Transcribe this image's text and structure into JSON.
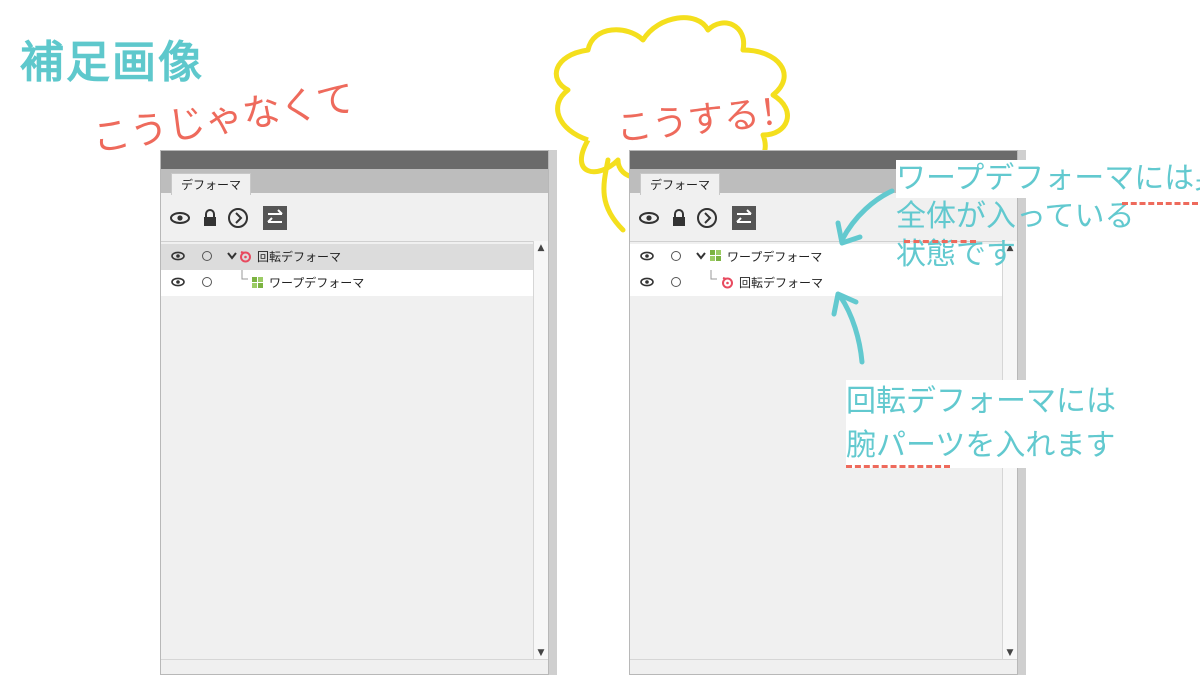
{
  "title": "補足画像",
  "annotations": {
    "wrong": "こうじゃなくて",
    "right": "こうする！",
    "note1": [
      "ワープデフォーマには身体",
      "全体が入っている",
      "状態です"
    ],
    "note2": [
      "回転デフォーマには",
      "腕パーツを入れます"
    ]
  },
  "panel_left": {
    "tab": "デフォーマ",
    "rows": [
      {
        "label": "回転デフォーマ",
        "type": "rotation",
        "expanded": true
      },
      {
        "label": "ワープデフォーマ",
        "type": "warp",
        "child": true
      }
    ]
  },
  "panel_right": {
    "tab": "デフォーマ",
    "rows": [
      {
        "label": "ワープデフォーマ",
        "type": "warp",
        "expanded": true
      },
      {
        "label": "回転デフォーマ",
        "type": "rotation",
        "child": true
      }
    ]
  },
  "colors": {
    "title_teal": "#5ec8cc",
    "note_teal": "#62c9cf",
    "hand_red": "#ee6a5c",
    "burst_yellow": "#f4df1d",
    "rotation_icon": "#e84a5f",
    "warp_icon": "#7cb342"
  },
  "icons": [
    "eye-icon",
    "lock-icon",
    "chevron-right-circle-icon",
    "swap-icon",
    "rotation-deformer-icon",
    "warp-deformer-icon"
  ]
}
